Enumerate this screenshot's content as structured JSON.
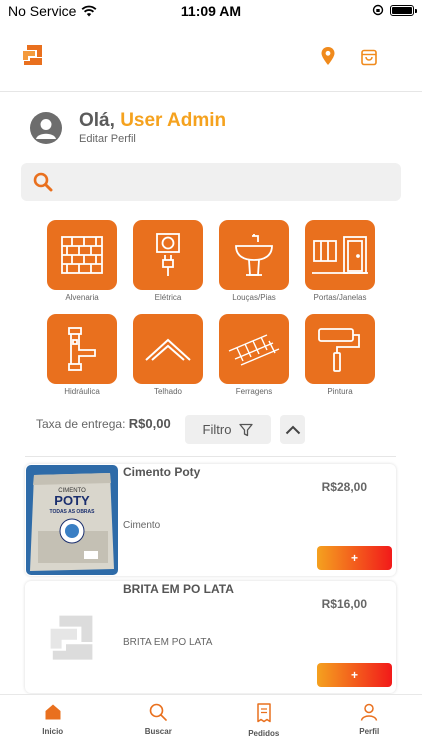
{
  "status_bar": {
    "carrier": "No Service",
    "time": "11:09 AM"
  },
  "header": {
    "logo_icon": "brand-logo-icon",
    "location_icon": "location-pin-icon",
    "cart_icon": "shopping-bag-icon"
  },
  "profile": {
    "greeting": "Olá,",
    "user_name": "User Admin",
    "edit_label": "Editar Perfil"
  },
  "search": {
    "placeholder": ""
  },
  "categories": [
    {
      "label": "Alvenaria",
      "icon": "brick-wall-icon"
    },
    {
      "label": "Elétrica",
      "icon": "electric-plug-icon"
    },
    {
      "label": "Louças/Pias",
      "icon": "sink-icon"
    },
    {
      "label": "Portas/Janelas",
      "icon": "door-window-icon"
    },
    {
      "label": "Hidráulica",
      "icon": "pipe-icon"
    },
    {
      "label": "Telhado",
      "icon": "roof-icon"
    },
    {
      "label": "Ferragens",
      "icon": "rebar-icon"
    },
    {
      "label": "Pintura",
      "icon": "paint-roller-icon"
    }
  ],
  "delivery": {
    "label": "Taxa de entrega:",
    "value": "R$0,00"
  },
  "filter": {
    "label": "Filtro"
  },
  "products": [
    {
      "name": "Cimento Poty",
      "price": "R$28,00",
      "category": "Cimento",
      "add_label": "+",
      "image_text_1": "CIMENTO",
      "image_text_2": "POTY",
      "image_text_3": "TODAS AS OBRAS"
    },
    {
      "name": "BRITA EM PO LATA",
      "price": "R$16,00",
      "category": "BRITA EM PO LATA",
      "add_label": "+"
    }
  ],
  "bottom_nav": [
    {
      "label": "Inicio",
      "icon": "home-icon"
    },
    {
      "label": "Buscar",
      "icon": "search-icon"
    },
    {
      "label": "Pedidos",
      "icon": "receipt-icon"
    },
    {
      "label": "Perfil",
      "icon": "user-icon"
    }
  ],
  "colors": {
    "brand_orange": "#e9701e",
    "accent_yellow": "#f5a21e",
    "button_gradient_end": "#f21a1a"
  }
}
